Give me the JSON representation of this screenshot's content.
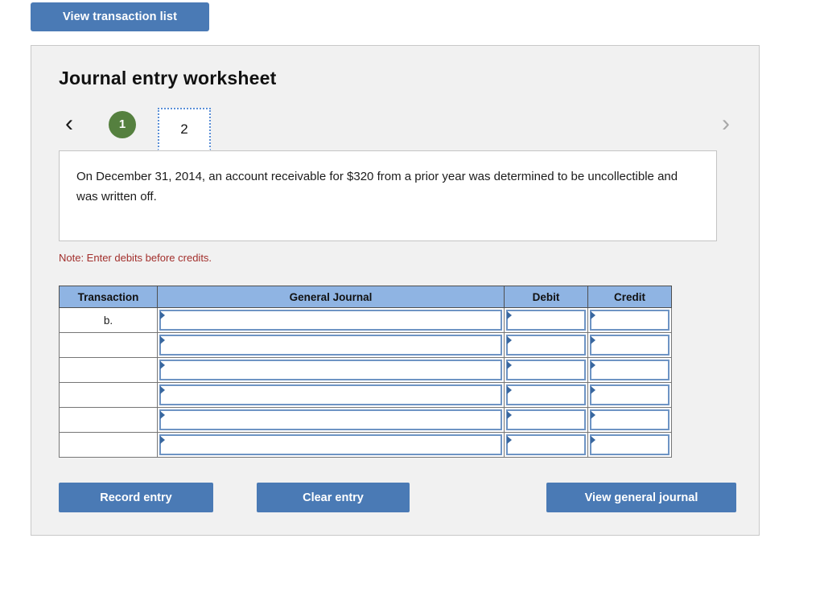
{
  "toolbar": {
    "view_transaction_list_label": "View transaction list"
  },
  "worksheet": {
    "title": "Journal entry worksheet",
    "pager": {
      "prev_icon": "‹",
      "next_icon": "›",
      "completed_page": "1",
      "active_page": "2"
    },
    "scenario_text": "On December 31, 2014, an account receivable for $320 from a prior year was determined to be uncollectible and was written off.",
    "note": "Note: Enter debits before credits.",
    "table": {
      "headers": [
        "Transaction",
        "General Journal",
        "Debit",
        "Credit"
      ],
      "rows": [
        {
          "transaction": "b.",
          "general_journal": "",
          "debit": "",
          "credit": ""
        },
        {
          "transaction": "",
          "general_journal": "",
          "debit": "",
          "credit": ""
        },
        {
          "transaction": "",
          "general_journal": "",
          "debit": "",
          "credit": ""
        },
        {
          "transaction": "",
          "general_journal": "",
          "debit": "",
          "credit": ""
        },
        {
          "transaction": "",
          "general_journal": "",
          "debit": "",
          "credit": ""
        },
        {
          "transaction": "",
          "general_journal": "",
          "debit": "",
          "credit": ""
        }
      ]
    },
    "buttons": {
      "record_entry": "Record entry",
      "clear_entry": "Clear entry",
      "view_general_journal": "View general journal"
    }
  },
  "colors": {
    "button_blue": "#4a7ab5",
    "header_blue": "#8fb4e3",
    "completed_green": "#55803f",
    "note_red": "#a22f2c",
    "panel_gray": "#f1f1f1",
    "field_border_blue": "#6e94c4"
  }
}
